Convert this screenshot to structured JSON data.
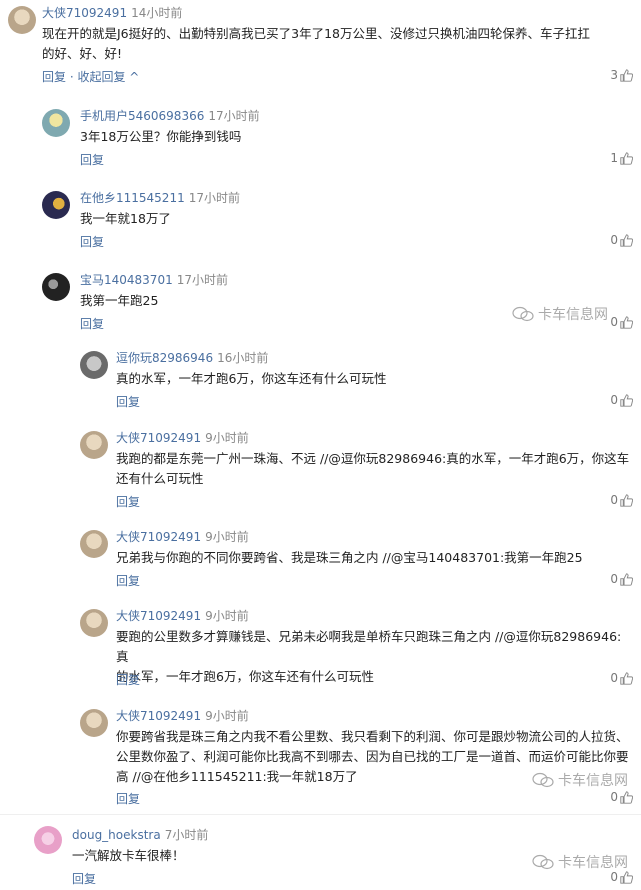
{
  "comments": [
    {
      "user": "大侠71092491",
      "time": "14小时前",
      "line1": "现在开的就是J6挺好的、出勤特别高我已买了3年了18万公里、没修过只换机油四轮保养、车子扛扛",
      "line2": "的好、好、好!",
      "reply": "回复",
      "collapse": "收起回复",
      "likes": "3",
      "avatar_color": "#b9a58a"
    },
    {
      "user": "手机用户5460698366",
      "time": "17小时前",
      "line1": "3年18万公里？你能挣到钱吗",
      "reply": "回复",
      "likes": "1",
      "avatar_color": "#7fa9b0"
    },
    {
      "user": "在他乡111545211",
      "time": "17小时前",
      "line1": "我一年就18万了",
      "reply": "回复",
      "likes": "0",
      "avatar_color": "#5a4a70"
    },
    {
      "user": "宝马140483701",
      "time": "17小时前",
      "line1": "我第一年跑25",
      "reply": "回复",
      "likes": "0",
      "avatar_color": "#3a3a3a"
    },
    {
      "user": "逗你玩82986946",
      "time": "16小时前",
      "line1": "真的水军，一年才跑6万，你这车还有什么可玩性",
      "reply": "回复",
      "likes": "0",
      "avatar_color": "#8a8a8a"
    },
    {
      "user": "大侠71092491",
      "time": "9小时前",
      "line1": "我跑的都是东莞一广州一珠海、不远 //@逗你玩82986946:真的水军，一年才跑6万，你这车",
      "line2": "还有什么可玩性",
      "reply": "回复",
      "likes": "0",
      "avatar_color": "#b9a58a"
    },
    {
      "user": "大侠71092491",
      "time": "9小时前",
      "line1": "兄弟我与你跑的不同你要跨省、我是珠三角之内 //@宝马140483701:我第一年跑25",
      "reply": "回复",
      "likes": "0",
      "avatar_color": "#b9a58a"
    },
    {
      "user": "大侠71092491",
      "time": "9小时前",
      "line1": "要跑的公里数多才算赚钱是、兄弟未必啊我是单桥车只跑珠三角之内 //@逗你玩82986946:真",
      "line2": "的水军，一年才跑6万，你这车还有什么可玩性",
      "reply": "回复",
      "likes": "0",
      "avatar_color": "#b9a58a"
    },
    {
      "user": "大侠71092491",
      "time": "9小时前",
      "line1": "你要跨省我是珠三角之内我不看公里数、我只看剩下的利润、你可是跟炒物流公司的人拉货、",
      "line2": "公里数你盈了、利润可能你比我高不到哪去、因为自已找的工厂是一道首、而运价可能比你要",
      "line3": "高 //@在他乡111545211:我一年就18万了",
      "reply": "回复",
      "likes": "0",
      "avatar_color": "#b9a58a"
    },
    {
      "user": "doug_hoekstra",
      "time": "7小时前",
      "line1": "一汽解放卡车很棒！",
      "reply": "回复",
      "likes": "0",
      "avatar_color": "#e8a0c8"
    }
  ],
  "watermark": "卡车信息网",
  "thumb_icon": "thumbs-up-icon"
}
